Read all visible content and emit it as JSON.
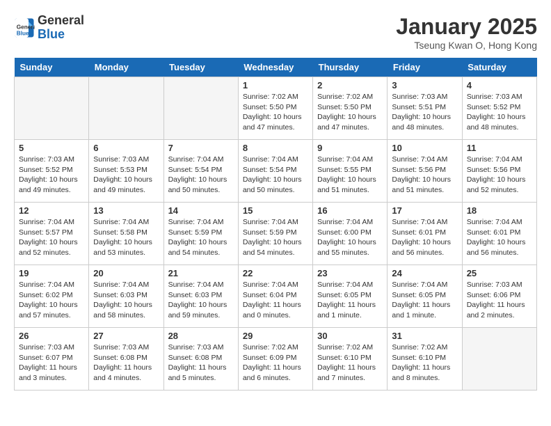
{
  "logo": {
    "text_general": "General",
    "text_blue": "Blue"
  },
  "title": "January 2025",
  "subtitle": "Tseung Kwan O, Hong Kong",
  "days_of_week": [
    "Sunday",
    "Monday",
    "Tuesday",
    "Wednesday",
    "Thursday",
    "Friday",
    "Saturday"
  ],
  "weeks": [
    [
      {
        "day": "",
        "empty": true
      },
      {
        "day": "",
        "empty": true
      },
      {
        "day": "",
        "empty": true
      },
      {
        "day": "1",
        "sunrise": "7:02 AM",
        "sunset": "5:50 PM",
        "daylight": "10 hours and 47 minutes."
      },
      {
        "day": "2",
        "sunrise": "7:02 AM",
        "sunset": "5:50 PM",
        "daylight": "10 hours and 47 minutes."
      },
      {
        "day": "3",
        "sunrise": "7:03 AM",
        "sunset": "5:51 PM",
        "daylight": "10 hours and 48 minutes."
      },
      {
        "day": "4",
        "sunrise": "7:03 AM",
        "sunset": "5:52 PM",
        "daylight": "10 hours and 48 minutes."
      }
    ],
    [
      {
        "day": "5",
        "sunrise": "7:03 AM",
        "sunset": "5:52 PM",
        "daylight": "10 hours and 49 minutes."
      },
      {
        "day": "6",
        "sunrise": "7:03 AM",
        "sunset": "5:53 PM",
        "daylight": "10 hours and 49 minutes."
      },
      {
        "day": "7",
        "sunrise": "7:04 AM",
        "sunset": "5:54 PM",
        "daylight": "10 hours and 50 minutes."
      },
      {
        "day": "8",
        "sunrise": "7:04 AM",
        "sunset": "5:54 PM",
        "daylight": "10 hours and 50 minutes."
      },
      {
        "day": "9",
        "sunrise": "7:04 AM",
        "sunset": "5:55 PM",
        "daylight": "10 hours and 51 minutes."
      },
      {
        "day": "10",
        "sunrise": "7:04 AM",
        "sunset": "5:56 PM",
        "daylight": "10 hours and 51 minutes."
      },
      {
        "day": "11",
        "sunrise": "7:04 AM",
        "sunset": "5:56 PM",
        "daylight": "10 hours and 52 minutes."
      }
    ],
    [
      {
        "day": "12",
        "sunrise": "7:04 AM",
        "sunset": "5:57 PM",
        "daylight": "10 hours and 52 minutes."
      },
      {
        "day": "13",
        "sunrise": "7:04 AM",
        "sunset": "5:58 PM",
        "daylight": "10 hours and 53 minutes."
      },
      {
        "day": "14",
        "sunrise": "7:04 AM",
        "sunset": "5:59 PM",
        "daylight": "10 hours and 54 minutes."
      },
      {
        "day": "15",
        "sunrise": "7:04 AM",
        "sunset": "5:59 PM",
        "daylight": "10 hours and 54 minutes."
      },
      {
        "day": "16",
        "sunrise": "7:04 AM",
        "sunset": "6:00 PM",
        "daylight": "10 hours and 55 minutes."
      },
      {
        "day": "17",
        "sunrise": "7:04 AM",
        "sunset": "6:01 PM",
        "daylight": "10 hours and 56 minutes."
      },
      {
        "day": "18",
        "sunrise": "7:04 AM",
        "sunset": "6:01 PM",
        "daylight": "10 hours and 56 minutes."
      }
    ],
    [
      {
        "day": "19",
        "sunrise": "7:04 AM",
        "sunset": "6:02 PM",
        "daylight": "10 hours and 57 minutes."
      },
      {
        "day": "20",
        "sunrise": "7:04 AM",
        "sunset": "6:03 PM",
        "daylight": "10 hours and 58 minutes."
      },
      {
        "day": "21",
        "sunrise": "7:04 AM",
        "sunset": "6:03 PM",
        "daylight": "10 hours and 59 minutes."
      },
      {
        "day": "22",
        "sunrise": "7:04 AM",
        "sunset": "6:04 PM",
        "daylight": "11 hours and 0 minutes."
      },
      {
        "day": "23",
        "sunrise": "7:04 AM",
        "sunset": "6:05 PM",
        "daylight": "11 hours and 1 minute."
      },
      {
        "day": "24",
        "sunrise": "7:04 AM",
        "sunset": "6:05 PM",
        "daylight": "11 hours and 1 minute."
      },
      {
        "day": "25",
        "sunrise": "7:03 AM",
        "sunset": "6:06 PM",
        "daylight": "11 hours and 2 minutes."
      }
    ],
    [
      {
        "day": "26",
        "sunrise": "7:03 AM",
        "sunset": "6:07 PM",
        "daylight": "11 hours and 3 minutes."
      },
      {
        "day": "27",
        "sunrise": "7:03 AM",
        "sunset": "6:08 PM",
        "daylight": "11 hours and 4 minutes."
      },
      {
        "day": "28",
        "sunrise": "7:03 AM",
        "sunset": "6:08 PM",
        "daylight": "11 hours and 5 minutes."
      },
      {
        "day": "29",
        "sunrise": "7:02 AM",
        "sunset": "6:09 PM",
        "daylight": "11 hours and 6 minutes."
      },
      {
        "day": "30",
        "sunrise": "7:02 AM",
        "sunset": "6:10 PM",
        "daylight": "11 hours and 7 minutes."
      },
      {
        "day": "31",
        "sunrise": "7:02 AM",
        "sunset": "6:10 PM",
        "daylight": "11 hours and 8 minutes."
      },
      {
        "day": "",
        "empty": true
      }
    ]
  ]
}
